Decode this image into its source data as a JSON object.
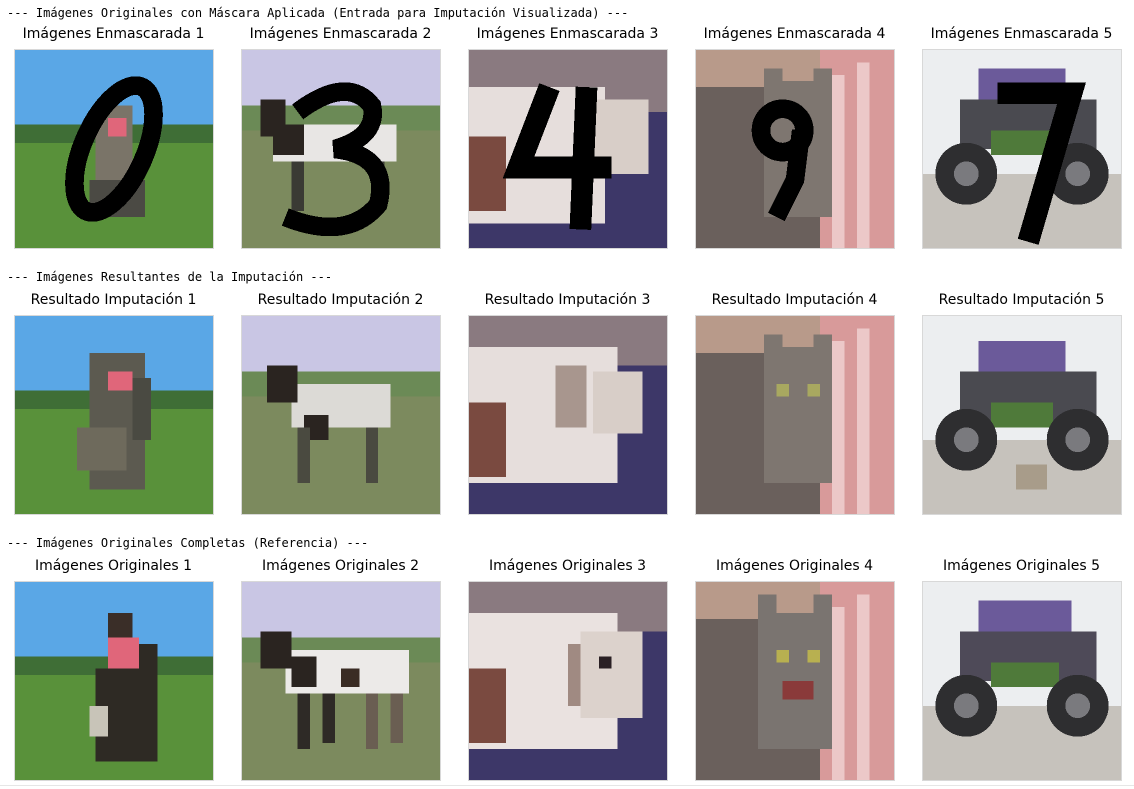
{
  "headers": {
    "masked": "--- Imágenes Originales con Máscara Aplicada (Entrada para Imputación Visualizada) ---",
    "imputed": "--- Imágenes Resultantes de la Imputación ---",
    "originals": "--- Imágenes Originales Completas (Referencia) ---"
  },
  "rows": {
    "masked": {
      "titles": [
        "Imágenes Enmascarada 1",
        "Imágenes Enmascarada 2",
        "Imágenes Enmascarada 3",
        "Imágenes Enmascarada 4",
        "Imágenes Enmascarada 5"
      ],
      "mask_digits": [
        "0",
        "3",
        "4",
        "9",
        "7"
      ]
    },
    "imputed": {
      "titles": [
        "Resultado Imputación 1",
        "Resultado Imputación 2",
        "Resultado Imputación 3",
        "Resultado Imputación 4",
        "Resultado Imputación 5"
      ]
    },
    "originals": {
      "titles": [
        "Imágenes Originales 1",
        "Imágenes Originales 2",
        "Imágenes Originales 3",
        "Imágenes Originales 4",
        "Imágenes Originales 5"
      ]
    }
  },
  "image_subjects": [
    "horse-with-rider",
    "running-horse",
    "white-horse-head",
    "gray-cat",
    "monster-truck"
  ],
  "colors": {
    "mask": "#000000",
    "sky": "#5aa7e6",
    "grass": "#59913a",
    "dusk": "#3d3768",
    "purple_truck": "#6b5a9a"
  }
}
